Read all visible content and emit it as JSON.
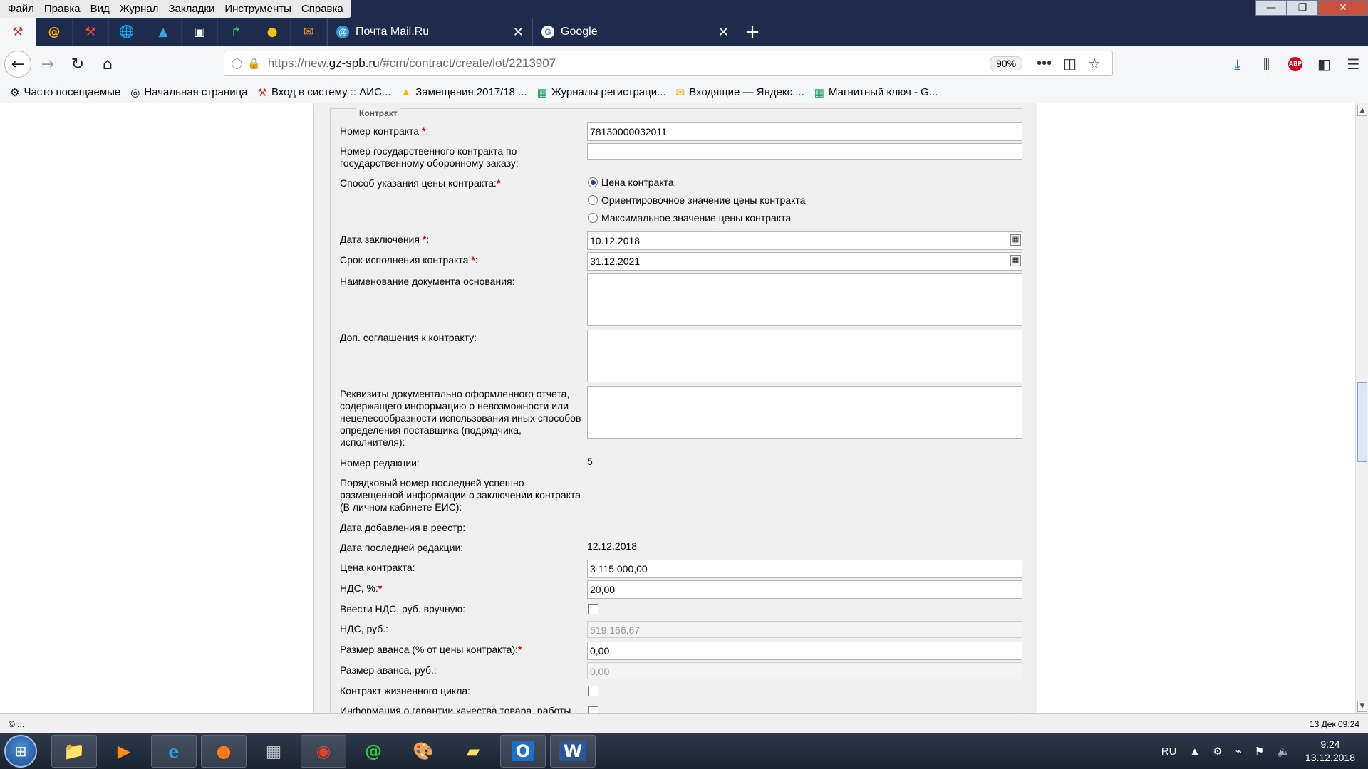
{
  "menu": {
    "items": [
      "Файл",
      "Правка",
      "Вид",
      "Журнал",
      "Закладки",
      "Инструменты",
      "Справка"
    ]
  },
  "window_controls": {
    "minimize": "—",
    "maximize": "❐",
    "close": "✕"
  },
  "pinned_tabs": [
    {
      "icon": "hammer-icon",
      "glyph": "⚒"
    },
    {
      "icon": "mailru-icon",
      "glyph": "@"
    },
    {
      "icon": "hammer-icon",
      "glyph": "⚒"
    },
    {
      "icon": "globe-icon",
      "glyph": "🌐"
    },
    {
      "icon": "chart-icon",
      "glyph": "▲"
    },
    {
      "icon": "window-icon",
      "glyph": "▣"
    },
    {
      "icon": "arrow-icon",
      "glyph": "↱"
    },
    {
      "icon": "coin-icon",
      "glyph": "●"
    },
    {
      "icon": "envelope-icon",
      "glyph": "✉"
    }
  ],
  "tabs": [
    {
      "title": "Почта Mail.Ru",
      "icon": "@",
      "active": false
    },
    {
      "title": "Google",
      "icon": "G",
      "active": false
    }
  ],
  "new_tab_glyph": "+",
  "nav": {
    "url_prefix": "https://new.",
    "url_domain": "gz-spb.ru",
    "url_path": "/#cm/contract/create/lot/2213907",
    "zoom": "90%"
  },
  "bookmarks": [
    {
      "label": "Часто посещаемые",
      "glyph": "⚙"
    },
    {
      "label": "Начальная страница",
      "glyph": "◎"
    },
    {
      "label": "Вход в систему :: АИС...",
      "glyph": "⚒"
    },
    {
      "label": "Замещения 2017/18 ...",
      "glyph": "▲"
    },
    {
      "label": "Журналы регистраци...",
      "glyph": "▦"
    },
    {
      "label": "Входящие — Яндекс....",
      "glyph": "✉"
    },
    {
      "label": "Магнитный ключ - G...",
      "glyph": "▦"
    }
  ],
  "form": {
    "legend": "Контракт",
    "contract_number_label": "Номер контракта",
    "contract_number": "78130000032011",
    "gov_defense_label": "Номер государственного контракта по государственному оборонному заказу:",
    "price_method_label": "Способ указания цены контракта:",
    "price_options": [
      "Цена контракта",
      "Ориентировочное значение цены контракта",
      "Максимальное значение цены контракта"
    ],
    "conclusion_date_label": "Дата заключения",
    "conclusion_date": "10.12.2018",
    "execution_term_label": "Срок исполнения контракта",
    "execution_term": "31.12.2021",
    "basis_doc_label": "Наименование документа основания:",
    "addendum_label": "Доп. соглашения к контракту:",
    "report_label": "Реквизиты документально оформленного отчета, содержащего информацию о невозможности или нецелесообразности использования иных способов определения поставщика (подрядчика, исполнителя):",
    "revision_label": "Номер редакции:",
    "revision": "5",
    "eis_number_label": "Порядковый номер последней успешно размещенной информации о заключении контракта (В личном кабинете ЕИС):",
    "registry_date_label": "Дата добавления в реестр:",
    "last_edit_label": "Дата последней редакции:",
    "last_edit": "12.12.2018",
    "price_label": "Цена контракта:",
    "price": "3 115 000,00",
    "vat_pct_label": "НДС, %:",
    "vat_pct": "20,00",
    "vat_manual_label": "Ввести НДС, руб. вручную:",
    "vat_rub_label": "НДС, руб.:",
    "vat_rub": "519 166,67",
    "advance_pct_label": "Размер аванса (% от цены контракта):",
    "advance_pct": "0,00",
    "advance_rub_label": "Размер аванса, руб.:",
    "advance_rub": "0,00",
    "lifecycle_label": "Контракт жизненного цикла:",
    "warranty_label": "Информация о гарантии качества товара, работы"
  },
  "status": {
    "left": "© ...",
    "right": "13 Дек 09:24"
  },
  "taskbar": {
    "apps": [
      "explorer-icon",
      "media-player-icon",
      "ie-icon",
      "firefox-icon",
      "calculator-icon",
      "chrome-icon",
      "mailru-agent-icon",
      "paint-icon",
      "sticky-notes-icon",
      "outlook-icon",
      "word-icon"
    ],
    "lang": "RU",
    "time": "9:24",
    "date": "13.12.2018"
  }
}
